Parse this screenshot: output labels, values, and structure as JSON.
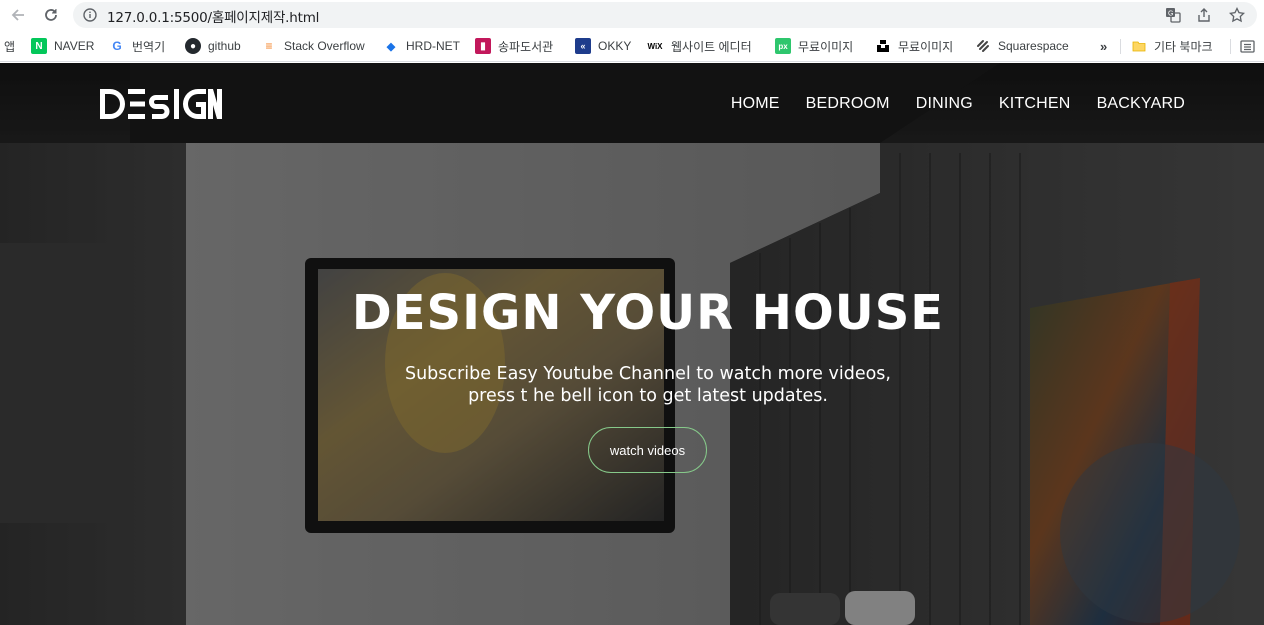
{
  "browser": {
    "url": "127.0.0.1:5500/홈페이지제작.html",
    "bookmarks": [
      {
        "label": "앱",
        "icon": "apps-icon"
      },
      {
        "label": "NAVER",
        "icon": "naver-icon"
      },
      {
        "label": "번역기",
        "icon": "google-icon"
      },
      {
        "label": "github",
        "icon": "github-icon"
      },
      {
        "label": "Stack Overflow",
        "icon": "stackoverflow-icon"
      },
      {
        "label": "HRD-NET",
        "icon": "hrdnet-icon"
      },
      {
        "label": "송파도서관",
        "icon": "library-icon"
      },
      {
        "label": "OKKY",
        "icon": "okky-icon"
      },
      {
        "label": "웹사이트 에디터",
        "icon": "wix-icon"
      },
      {
        "label": "무료이미지",
        "icon": "pixabay-icon"
      },
      {
        "label": "무료이미지",
        "icon": "unsplash-icon"
      },
      {
        "label": "Squarespace",
        "icon": "squarespace-icon"
      }
    ],
    "more_label": "»",
    "other_bookmarks": "기타 북마크"
  },
  "site": {
    "logo": "DESIGN",
    "nav": [
      "HOME",
      "BEDROOM",
      "DINING",
      "KITCHEN",
      "BACKYARD"
    ],
    "headline": "DESIGN YOUR HOUSE",
    "subtitle_line1": "Subscribe Easy Youtube Channel to watch more videos,",
    "subtitle_line2": "press t he bell icon to get latest updates.",
    "cta": "watch videos"
  },
  "colors": {
    "cta_border": "#86c98a",
    "text": "#ffffff"
  }
}
